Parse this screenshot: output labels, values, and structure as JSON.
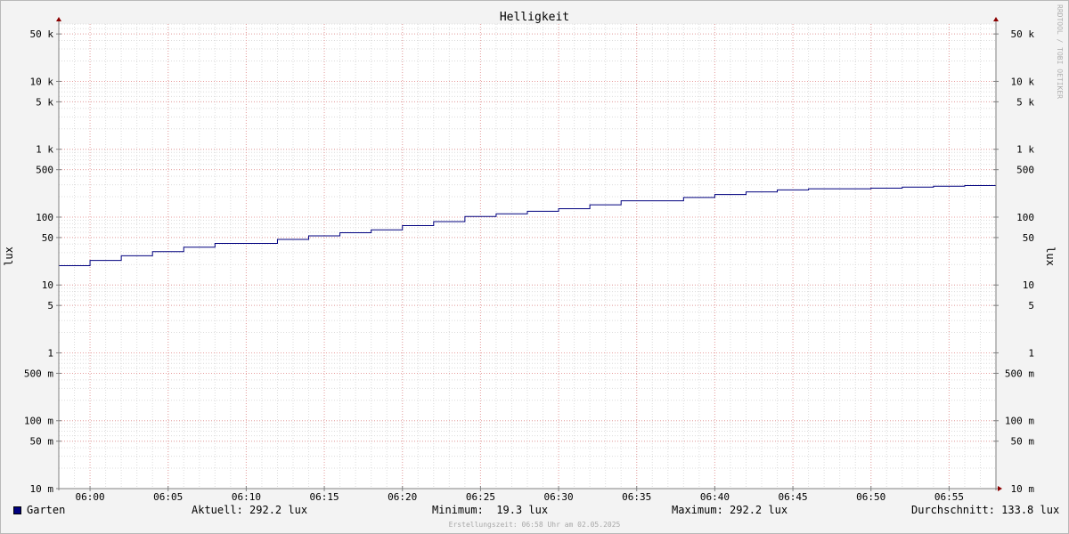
{
  "chart_data": {
    "type": "line",
    "title": "Helligkeit",
    "ylabel": "lux",
    "y_scale": "log",
    "ylim": [
      0.01,
      70000
    ],
    "xlim": [
      "05:58",
      "06:58"
    ],
    "x_ticks": [
      "06:00",
      "06:05",
      "06:10",
      "06:15",
      "06:20",
      "06:25",
      "06:30",
      "06:35",
      "06:40",
      "06:45",
      "06:50",
      "06:55"
    ],
    "y_ticks": [
      {
        "value": 50000,
        "label": "50 k"
      },
      {
        "value": 10000,
        "label": "10 k"
      },
      {
        "value": 5000,
        "label": "5 k"
      },
      {
        "value": 1000,
        "label": "1 k"
      },
      {
        "value": 500,
        "label": "500"
      },
      {
        "value": 100,
        "label": "100"
      },
      {
        "value": 50,
        "label": "50"
      },
      {
        "value": 10,
        "label": "10"
      },
      {
        "value": 5,
        "label": "5"
      },
      {
        "value": 1,
        "label": "1"
      },
      {
        "value": 0.5,
        "label": "500 m"
      },
      {
        "value": 0.1,
        "label": "100 m"
      },
      {
        "value": 0.05,
        "label": "50 m"
      },
      {
        "value": 0.01,
        "label": "10 m"
      }
    ],
    "grid": true,
    "series": [
      {
        "name": "Garten",
        "color": "#00007f",
        "step": true,
        "points": [
          {
            "t": "05:58",
            "v": 19.3
          },
          {
            "t": "06:00",
            "v": 23
          },
          {
            "t": "06:02",
            "v": 27
          },
          {
            "t": "06:04",
            "v": 31
          },
          {
            "t": "06:06",
            "v": 36
          },
          {
            "t": "06:08",
            "v": 41
          },
          {
            "t": "06:12",
            "v": 47
          },
          {
            "t": "06:14",
            "v": 53
          },
          {
            "t": "06:16",
            "v": 59
          },
          {
            "t": "06:18",
            "v": 65
          },
          {
            "t": "06:20",
            "v": 75
          },
          {
            "t": "06:22",
            "v": 86
          },
          {
            "t": "06:24",
            "v": 102
          },
          {
            "t": "06:26",
            "v": 112
          },
          {
            "t": "06:28",
            "v": 122
          },
          {
            "t": "06:30",
            "v": 133
          },
          {
            "t": "06:32",
            "v": 152
          },
          {
            "t": "06:34",
            "v": 174
          },
          {
            "t": "06:38",
            "v": 195
          },
          {
            "t": "06:40",
            "v": 215
          },
          {
            "t": "06:42",
            "v": 235
          },
          {
            "t": "06:44",
            "v": 252
          },
          {
            "t": "06:46",
            "v": 262
          },
          {
            "t": "06:50",
            "v": 268
          },
          {
            "t": "06:52",
            "v": 277
          },
          {
            "t": "06:54",
            "v": 285
          },
          {
            "t": "06:56",
            "v": 292.2
          },
          {
            "t": "06:58",
            "v": 292.2
          }
        ]
      }
    ]
  },
  "legend": {
    "series_name": "Garten",
    "series_color": "#00007f",
    "current": "Aktuell: 292.2 lux",
    "minimum": "Minimum:  19.3 lux",
    "maximum": "Maximum: 292.2 lux",
    "average": "Durchschnitt: 133.8 lux"
  },
  "footer": "Erstellungszeit: 06:58 Uhr am 02.05.2025",
  "watermark": "RRDTOOL / TOBI OETIKER"
}
